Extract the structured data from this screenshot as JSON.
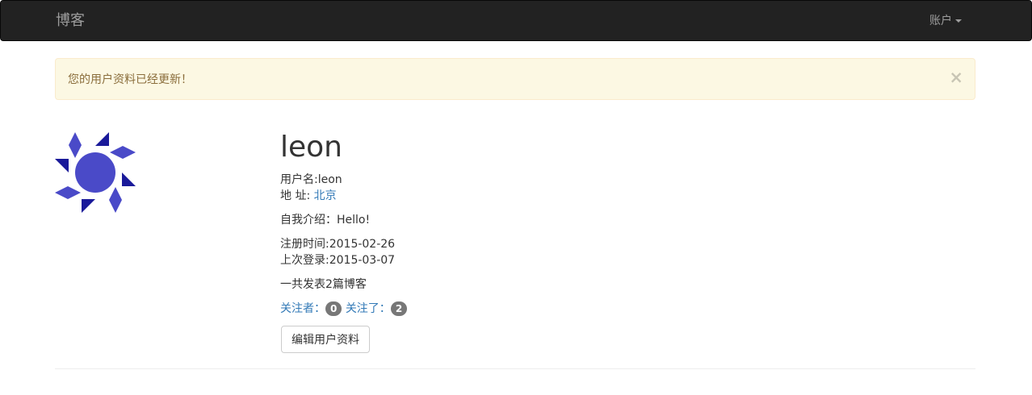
{
  "navbar": {
    "brand": "博客",
    "account_label": "账户"
  },
  "alert": {
    "message": "您的用户资料已经更新！",
    "close_symbol": "×"
  },
  "profile": {
    "username": "leon",
    "username_label": "用户名:",
    "username_value": "leon",
    "location_label": "地 址: ",
    "location_value": "北京",
    "about_label": "自我介绍：",
    "about_value": "Hello!",
    "member_since_label": "注册时间:",
    "member_since_value": "2015-02-26",
    "last_seen_label": "上次登录:",
    "last_seen_value": "2015-03-07",
    "post_count_text": "一共发表2篇博客",
    "followers_label": "关注者：",
    "followers_count": "0",
    "following_label": "关注了：",
    "following_count": "2",
    "edit_button_label": "编辑用户资料"
  },
  "colors": {
    "navbar_bg": "#222222",
    "alert_bg": "#fcf8e3",
    "alert_text": "#8a6d3b",
    "link": "#337ab7",
    "avatar_primary": "#4a4ac8",
    "avatar_dark": "#1a1a9a"
  },
  "avatar_icon": "sun-identicon-icon"
}
